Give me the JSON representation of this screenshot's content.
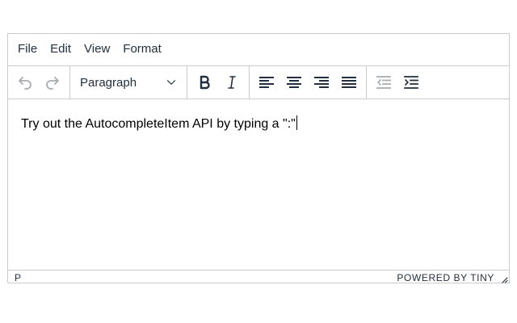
{
  "menubar": {
    "items": [
      {
        "label": "File"
      },
      {
        "label": "Edit"
      },
      {
        "label": "View"
      },
      {
        "label": "Format"
      }
    ]
  },
  "toolbar": {
    "block_format": "Paragraph",
    "undo_icon": "undo-icon",
    "redo_icon": "redo-icon",
    "bold_icon": "bold-icon",
    "italic_icon": "italic-icon",
    "align_left_icon": "align-left-icon",
    "align_center_icon": "align-center-icon",
    "align_right_icon": "align-right-icon",
    "align_justify_icon": "align-justify-icon",
    "outdent_icon": "outdent-icon",
    "indent_icon": "indent-icon",
    "enabled_color": "#222f3e",
    "disabled_color": "#a6abb0"
  },
  "content": {
    "text": "Try out the AutocompleteItem API by typing a \":\""
  },
  "statusbar": {
    "path": "P",
    "branding": "POWERED BY TINY"
  }
}
